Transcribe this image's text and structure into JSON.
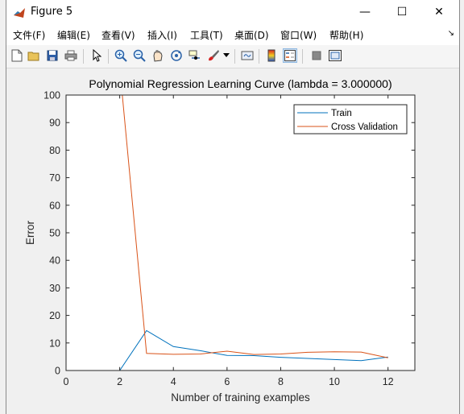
{
  "window": {
    "title": "Figure 5",
    "controls": {
      "minimize": "—",
      "maximize": "☐",
      "close": "✕"
    }
  },
  "menu": {
    "items": [
      "文件(F)",
      "编辑(E)",
      "查看(V)",
      "插入(I)",
      "工具(T)",
      "桌面(D)",
      "窗口(W)",
      "帮助(H)"
    ]
  },
  "toolbar": {
    "buttons": [
      "new-figure-icon",
      "open-file-icon",
      "save-icon",
      "print-icon",
      "pointer-icon",
      "zoom-in-icon",
      "zoom-out-icon",
      "pan-hand-icon",
      "rotate-3d-icon",
      "data-cursor-icon",
      "brush-icon",
      "brush-dropdown-icon",
      "link-plot-icon",
      "colorbar-icon",
      "legend-icon",
      "hide-plot-tools-icon",
      "show-plot-tools-icon"
    ]
  },
  "colors": {
    "train": "#0072BD",
    "cv": "#D95319",
    "axes_bg": "#ffffff",
    "figure_bg": "#f0f0f0"
  },
  "chart_data": {
    "type": "line",
    "title": "Polynomial Regression Learning Curve (lambda = 3.000000)",
    "xlabel": "Number of training examples",
    "ylabel": "Error",
    "xlim": [
      0,
      13
    ],
    "ylim": [
      0,
      100
    ],
    "xticks": [
      0,
      2,
      4,
      6,
      8,
      10,
      12
    ],
    "yticks": [
      0,
      10,
      20,
      30,
      40,
      50,
      60,
      70,
      80,
      90,
      100
    ],
    "legend_position": "top-right",
    "grid": false,
    "series": [
      {
        "name": "Train",
        "color": "#0072BD",
        "x": [
          1,
          2,
          3,
          4,
          5,
          6,
          7,
          8,
          9,
          10,
          11,
          12
        ],
        "y": [
          0,
          0,
          14.5,
          8.7,
          7.2,
          5.5,
          5.4,
          4.8,
          4.4,
          4.0,
          3.6,
          4.9
        ]
      },
      {
        "name": "Cross Validation",
        "color": "#D95319",
        "x": [
          1,
          2,
          3,
          4,
          5,
          6,
          7,
          8,
          9,
          10,
          11,
          12
        ],
        "y": [
          160,
          110,
          6.2,
          5.9,
          6.0,
          7.0,
          5.8,
          6.0,
          6.6,
          6.8,
          6.7,
          4.6
        ]
      }
    ]
  }
}
